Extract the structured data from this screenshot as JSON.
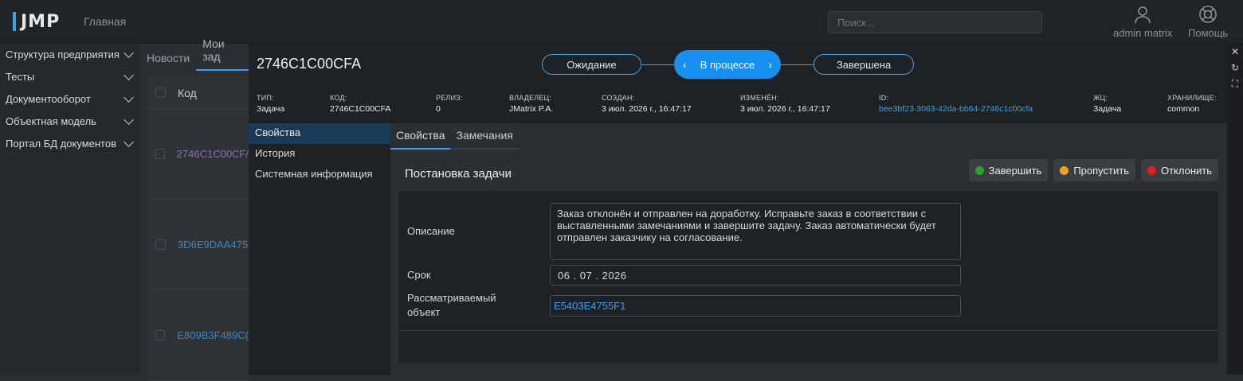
{
  "app": {
    "logo": "JMP",
    "home_link": "Главная"
  },
  "search": {
    "placeholder": "Поиск..."
  },
  "user": {
    "label": "admin matrix",
    "icon": "user-icon"
  },
  "help": {
    "label": "Помощь",
    "icon": "lifebuoy-icon"
  },
  "nav": [
    {
      "label": "Структура предприятия"
    },
    {
      "label": "Тесты"
    },
    {
      "label": "Документооборот"
    },
    {
      "label": "Объектная модель"
    },
    {
      "label": "Портал БД документов"
    }
  ],
  "background": {
    "tabs": [
      "Новости",
      "Мои зад"
    ],
    "column_header": "Код",
    "rows": [
      "2746C1C00CF/",
      "3D6E9DAA475",
      "E809B3F489C("
    ]
  },
  "object": {
    "title": "2746C1C00CFA",
    "states": {
      "prev": "Ожидание",
      "current": "В процессе",
      "next": "Завершена"
    },
    "meta": [
      {
        "key": "ТИП:",
        "value": "Задача"
      },
      {
        "key": "КОД:",
        "value": "2746C1C00CFA"
      },
      {
        "key": "РЕЛИЗ:",
        "value": "0"
      },
      {
        "key": "ВЛАДЕЛЕЦ:",
        "value": "JMatrix P.A."
      },
      {
        "key": "СОЗДАН:",
        "value": "3 июл. 2026 г., 16:47:17"
      },
      {
        "key": "ИЗМЕНЁН:",
        "value": "3 июл. 2026 г., 16:47:17"
      },
      {
        "key": "ID:",
        "value": "bee3bf23-3063-42da-bb64-2746c1c00cfa"
      },
      {
        "key": "ЖЦ:",
        "value": "Задача"
      },
      {
        "key": "ХРАНИЛИЩЕ:",
        "value": "common"
      }
    ],
    "side_tabs": [
      "Свойства",
      "История",
      "Системная информация"
    ],
    "content_tabs": [
      "Свойства",
      "Замечания"
    ]
  },
  "form": {
    "title": "Постановка задачи",
    "actions": [
      {
        "label": "Завершить",
        "color": "#2aa52a"
      },
      {
        "label": "Пропустить",
        "color": "#f0a020"
      },
      {
        "label": "Отклонить",
        "color": "#e02020"
      }
    ],
    "description_label": "Описание",
    "description_value": "Заказ отклонён и отправлен на доработку. Исправьте заказ в соответствии с выставленными замечаниями и завершите задачу. Заказ автоматически будет отправлен заказчику на согласование.",
    "due_label": "Срок",
    "due_value": "06 . 07 . 2026",
    "object_label": "Рассматриваемый объект",
    "object_value": "E5403E4755F1"
  },
  "rail": {
    "icons": [
      "close-icon",
      "refresh-icon",
      "fullscreen-icon"
    ]
  }
}
